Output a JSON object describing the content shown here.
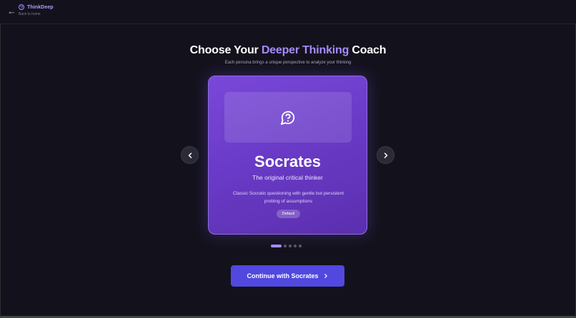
{
  "header": {
    "brand_name": "ThinkDeep",
    "back_link": "Back to home",
    "back_arrow": "←"
  },
  "hero": {
    "title_before": "Choose Your ",
    "title_accent": "Deeper Thinking",
    "title_after": " Coach",
    "subtitle": "Each persona brings a unique perspective to analyze your thinking"
  },
  "carousel": {
    "current_index": 1,
    "total": 5,
    "persona": {
      "icon": "message-question-icon",
      "name": "Socrates",
      "tagline": "The original critical thinker",
      "description": "Classic Socratic questioning with gentle but persistent probing of assumptions",
      "badge": "Default"
    },
    "prev_icon": "chevron-left-icon",
    "next_icon": "chevron-right-icon"
  },
  "cta": {
    "label": "Continue with Socrates",
    "icon": "chevron-right-icon"
  },
  "colors": {
    "background": "#13121c",
    "accent": "#a78bfa",
    "card": "#6a3bc8",
    "button": "#5148e0"
  }
}
